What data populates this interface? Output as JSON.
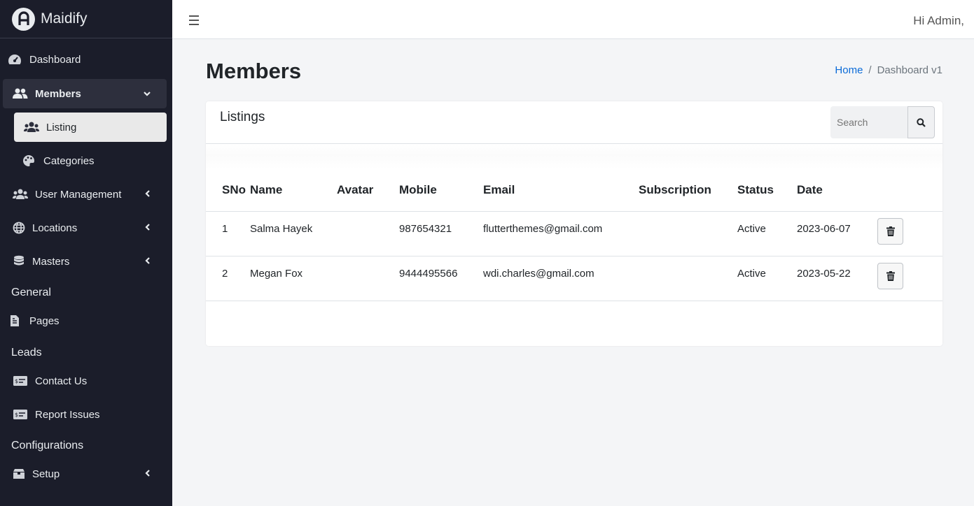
{
  "brand": {
    "name": "Maidify"
  },
  "sidebar": {
    "items": [
      {
        "label": "Dashboard",
        "icon": "tachometer-icon"
      },
      {
        "label": "Members",
        "icon": "users-icon",
        "expanded": true
      },
      {
        "label": "Listing",
        "icon": "users-group-icon",
        "active": true
      },
      {
        "label": "Categories",
        "icon": "palette-icon"
      },
      {
        "label": "User Management",
        "icon": "users-icon"
      },
      {
        "label": "Locations",
        "icon": "globe-icon"
      },
      {
        "label": "Masters",
        "icon": "database-icon"
      },
      {
        "label": "Pages",
        "icon": "file-icon"
      },
      {
        "label": "Contact Us",
        "icon": "money-check-icon"
      },
      {
        "label": "Report Issues",
        "icon": "money-check-icon"
      },
      {
        "label": "Setup",
        "icon": "box-icon"
      }
    ],
    "headers": [
      "General",
      "Leads",
      "Configurations"
    ]
  },
  "topbar": {
    "greeting": "Hi Admin,"
  },
  "page": {
    "title": "Members",
    "breadcrumb": {
      "home": "Home",
      "separator": "/",
      "current": "Dashboard v1"
    }
  },
  "card": {
    "title": "Listings",
    "search_placeholder": "Search"
  },
  "table": {
    "columns": [
      "SNo",
      "Name",
      "Avatar",
      "Mobile",
      "Email",
      "Subscription",
      "Status",
      "Date"
    ],
    "rows": [
      {
        "sno": "1",
        "name": "Salma Hayek",
        "avatar": "",
        "mobile": "987654321",
        "email": "flutterthemes@gmail.com",
        "subscription": "",
        "status": "Active",
        "date": "2023-06-07"
      },
      {
        "sno": "2",
        "name": "Megan Fox",
        "avatar": "",
        "mobile": "9444495566",
        "email": "wdi.charles@gmail.com",
        "subscription": "",
        "status": "Active",
        "date": "2023-05-22"
      }
    ]
  },
  "colors": {
    "sidebar_bg": "#1b1d2a",
    "link": "#0b6bd8",
    "page_bg": "#f4f5f7"
  }
}
